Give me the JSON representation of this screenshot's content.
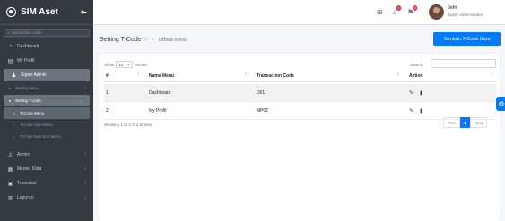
{
  "app": {
    "title": "SIM Aset",
    "collapse_glyph": "⇤"
  },
  "sidebar": {
    "search_placeholder": "transaction code",
    "items": [
      {
        "label": "Dashboard",
        "icon": "dashboard-icon"
      },
      {
        "label": "My Profil",
        "icon": "profile-icon"
      },
      {
        "label": "Super Admin",
        "icon": "user-admin-icon"
      },
      {
        "label": "Setting Menu"
      },
      {
        "label": "Setting T-code"
      },
      {
        "label": "T-Code Menu"
      },
      {
        "label": "T-Code Sub Menu"
      },
      {
        "label": "T-Code Sub Sub Menu"
      },
      {
        "label": "Admin",
        "icon": "user-icon"
      },
      {
        "label": "Master Data",
        "icon": "database-icon"
      },
      {
        "label": "Transaksi",
        "icon": "transaction-icon"
      },
      {
        "label": "Laporan",
        "icon": "report-icon"
      }
    ]
  },
  "topbar": {
    "notif_badge": "1",
    "alert_badge": "0",
    "user_name": "Jefri",
    "user_role": "Super Administrator"
  },
  "header": {
    "title": "Setting T-Code",
    "breadcrumb_item": "Tambah Menu",
    "add_button": "Tambah T-Code Baru"
  },
  "table": {
    "show_label": "Show",
    "length_value": "10",
    "entries_label": "entries",
    "search_label": "Search:",
    "columns": [
      "#",
      "Nama Menu",
      "Transaction Code",
      "Action"
    ],
    "rows": [
      {
        "no": "1",
        "menu": "Dashboard",
        "code": "D01"
      },
      {
        "no": "2",
        "menu": "My Profil",
        "code": "MP02"
      }
    ],
    "info": "Showing 1 to 2 of 2 entries",
    "prev": "Prev",
    "page": "1",
    "next": "Next"
  },
  "colors": {
    "sidebar": "#343a40",
    "primary": "#007bff",
    "danger": "#dc3545"
  }
}
